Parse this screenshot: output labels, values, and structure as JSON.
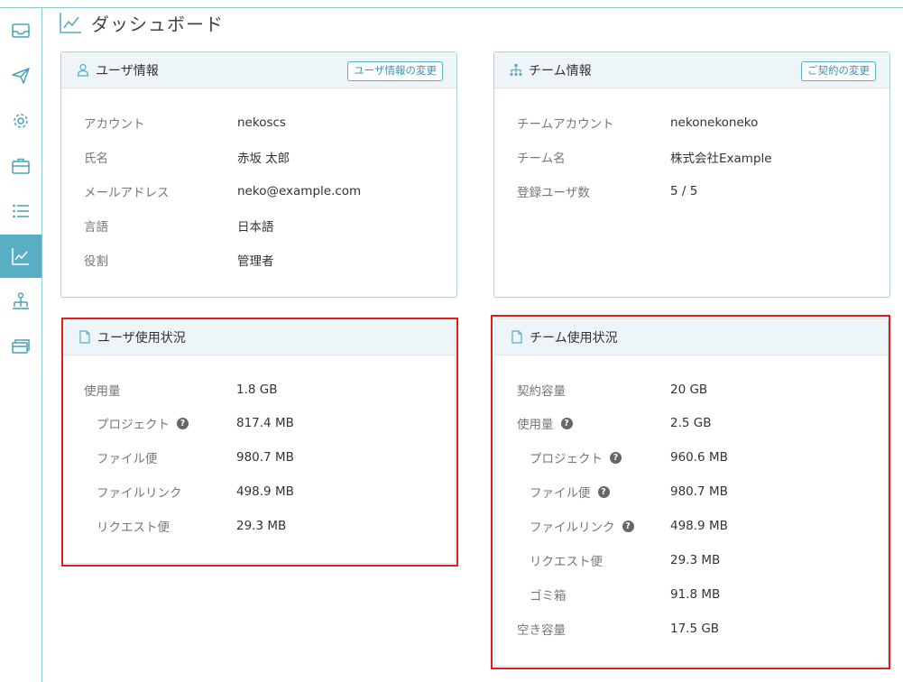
{
  "page": {
    "title": "ダッシュボード"
  },
  "sidebar": {
    "items": [
      {
        "icon": "inbox-icon",
        "active": false
      },
      {
        "icon": "send-icon",
        "active": false
      },
      {
        "icon": "gear-icon",
        "active": false
      },
      {
        "icon": "briefcase-icon",
        "active": false
      },
      {
        "icon": "list-icon",
        "active": false
      },
      {
        "icon": "chart-icon",
        "active": true
      },
      {
        "icon": "team-icon",
        "active": false
      },
      {
        "icon": "cards-icon",
        "active": false
      }
    ]
  },
  "user_info": {
    "title": "ユーザ情報",
    "button": "ユーザ情報の変更",
    "rows": [
      {
        "label": "アカウント",
        "value": "nekoscs"
      },
      {
        "label": "氏名",
        "value": "赤坂 太郎"
      },
      {
        "label": "メールアドレス",
        "value": "neko@example.com"
      },
      {
        "label": "言語",
        "value": "日本語"
      },
      {
        "label": "役割",
        "value": "管理者"
      }
    ]
  },
  "team_info": {
    "title": "チーム情報",
    "button": "ご契約の変更",
    "rows": [
      {
        "label": "チームアカウント",
        "value": "nekonekoneko"
      },
      {
        "label": "チーム名",
        "value": "株式会社Example"
      },
      {
        "label": "登録ユーザ数",
        "value": "5 / 5"
      }
    ]
  },
  "user_usage": {
    "title": "ユーザ使用状況",
    "rows": [
      {
        "label": "使用量",
        "value": "1.8 GB"
      },
      {
        "label": "プロジェクト",
        "value": "817.4 MB"
      },
      {
        "label": "ファイル便",
        "value": "980.7 MB"
      },
      {
        "label": "ファイルリンク",
        "value": "498.9 MB"
      },
      {
        "label": "リクエスト便",
        "value": "29.3 MB"
      }
    ]
  },
  "team_usage": {
    "title": "チーム使用状況",
    "rows": [
      {
        "label": "契約容量",
        "value": "20 GB"
      },
      {
        "label": "使用量",
        "value": "2.5 GB"
      },
      {
        "label": "プロジェクト",
        "value": "960.6 MB"
      },
      {
        "label": "ファイル便",
        "value": "980.7 MB"
      },
      {
        "label": "ファイルリンク",
        "value": "498.9 MB"
      },
      {
        "label": "リクエスト便",
        "value": "29.3 MB"
      },
      {
        "label": "ゴミ箱",
        "value": "91.8 MB"
      },
      {
        "label": "空き容量",
        "value": "17.5 GB"
      }
    ]
  },
  "colors": {
    "accent": "#5aaec4",
    "highlight_border": "#e21b1b",
    "card_header_bg": "#eef5f8"
  }
}
